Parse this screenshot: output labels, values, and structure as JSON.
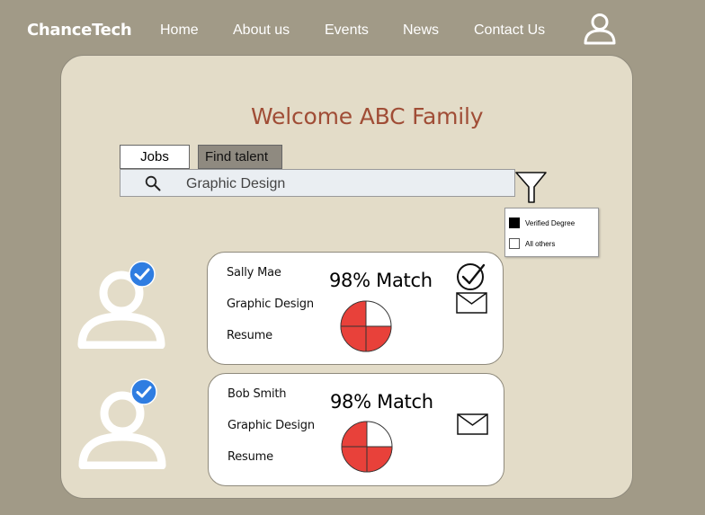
{
  "header": {
    "brand": "ChanceTech",
    "nav": [
      "Home",
      "About us",
      "Events",
      "News",
      "Contact Us"
    ],
    "profile_icon": "user-icon"
  },
  "main": {
    "welcome": "Welcome ABC Family",
    "tabs": [
      {
        "label": "Jobs",
        "selected": true
      },
      {
        "label": "Find talent",
        "selected": false
      }
    ],
    "search": {
      "value": "Graphic Design",
      "icon": "search-icon"
    },
    "filter": {
      "icon": "funnel-icon",
      "options": [
        {
          "label": "Verified Degree",
          "checked": true
        },
        {
          "label": "All others",
          "checked": false
        }
      ]
    },
    "candidates": [
      {
        "name": "Sally Mae",
        "field": "Graphic Design",
        "resume": "Resume",
        "match": "98% Match",
        "match_fraction": 0.98,
        "verified": true,
        "actions": [
          "approve-check-icon",
          "mail-icon"
        ]
      },
      {
        "name": "Bob Smith",
        "field": "Graphic Design",
        "resume": "Resume",
        "match": "98% Match",
        "match_fraction": 0.98,
        "verified": true,
        "actions": [
          "mail-icon"
        ]
      }
    ]
  },
  "colors": {
    "background": "#a19a87",
    "panel": "#e3dcc8",
    "welcome_text": "#a04d36",
    "pie_fill": "#e8413a",
    "verified_badge": "#2f7de1"
  }
}
